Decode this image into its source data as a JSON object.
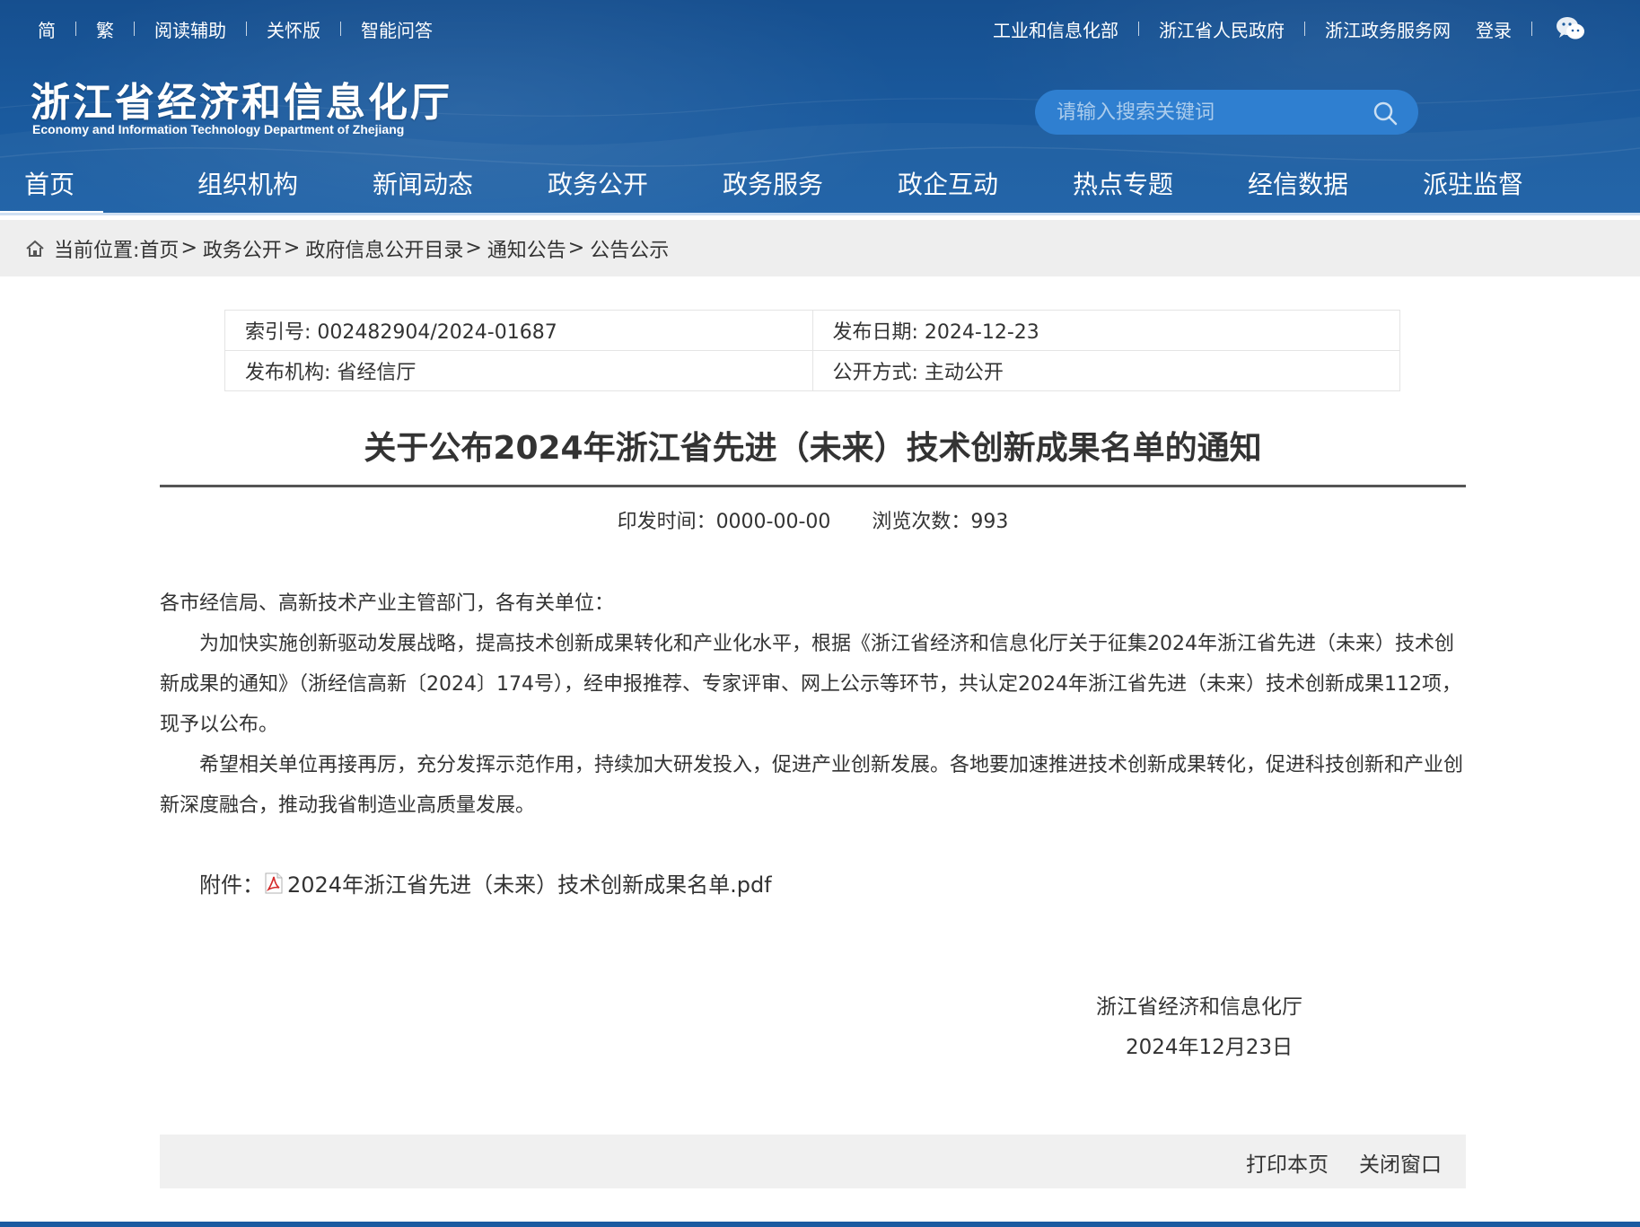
{
  "topbar": {
    "left_links": [
      "简",
      "繁",
      "阅读辅助",
      "关怀版",
      "智能问答"
    ],
    "right_links": [
      "工业和信息化部",
      "浙江省人民政府",
      "浙江政务服务网",
      "登录"
    ],
    "wechat_icon": "wechat-icon"
  },
  "brand": {
    "name_cn": "浙江省经济和信息化厅",
    "name_en": "Economy and Information Technology Department of Zhejiang"
  },
  "search": {
    "placeholder": "请输入搜索关键词",
    "icon": "search-icon"
  },
  "nav": {
    "items": [
      "首页",
      "组织机构",
      "新闻动态",
      "政务公开",
      "政务服务",
      "政企互动",
      "热点专题",
      "经信数据",
      "派驻监督"
    ],
    "active": "首页"
  },
  "breadcrumb": {
    "prefix": "当前位置:",
    "items": [
      "首页",
      "政务公开",
      "政府信息公开目录",
      "通知公告",
      "公告公示"
    ],
    "separator": ">"
  },
  "meta": {
    "index_no": "索引号: 002482904/2024-01687",
    "publish_date": "发布日期: 2024-12-23",
    "publisher": "发布机构: 省经信厅",
    "disclosure": "公开方式: 主动公开"
  },
  "article": {
    "title": "关于公布2024年浙江省先进（未来）技术创新成果名单的通知",
    "issue_time": "印发时间：0000-00-00",
    "views": "浏览次数：993",
    "salutation": "各市经信局、高新技术产业主管部门，各有关单位：",
    "paragraph1": "为加快实施创新驱动发展战略，提高技术创新成果转化和产业化水平，根据《浙江省经济和信息化厅关于征集2024年浙江省先进（未来）技术创新成果的通知》（浙经信高新〔2024〕174号），经申报推荐、专家评审、网上公示等环节，共认定2024年浙江省先进（未来）技术创新成果112项，现予以公布。",
    "paragraph2": "希望相关单位再接再厉，充分发挥示范作用，持续加大研发投入，促进产业创新发展。各地要加速推进技术创新成果转化，促进科技创新和产业创新深度融合，推动我省制造业高质量发展。",
    "attachment_label": "附件：",
    "attachment_file": "2024年浙江省先进（未来）技术创新成果名单.pdf",
    "signature_org": "浙江省经济和信息化厅",
    "signature_date": "2024年12月23日"
  },
  "footer": {
    "print": "打印本页",
    "close": "关闭窗口"
  }
}
